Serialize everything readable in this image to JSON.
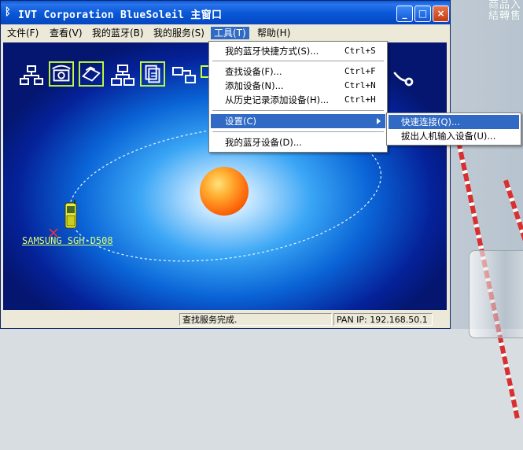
{
  "window": {
    "title": "IVT Corporation BlueSoleil 主窗口",
    "minimize": "_",
    "maximize": "□",
    "close": "×"
  },
  "menubar": [
    {
      "label": "文件(F)"
    },
    {
      "label": "查看(V)"
    },
    {
      "label": "我的蓝牙(B)"
    },
    {
      "label": "我的服务(S)"
    },
    {
      "label": "工具(T)"
    },
    {
      "label": "帮助(H)"
    }
  ],
  "tools_menu": {
    "items": [
      {
        "label": "我的蓝牙快捷方式(S)...",
        "shortcut": "Ctrl+S"
      },
      {
        "label": "查找设备(F)...",
        "shortcut": "Ctrl+F"
      },
      {
        "label": "添加设备(N)...",
        "shortcut": "Ctrl+N"
      },
      {
        "label": "从历史记录添加设备(H)...",
        "shortcut": "Ctrl+H"
      },
      {
        "label": "设置(C)",
        "shortcut": ""
      },
      {
        "label": "我的蓝牙设备(D)...",
        "shortcut": ""
      }
    ]
  },
  "settings_submenu": {
    "items": [
      {
        "label": "快速连接(Q)..."
      },
      {
        "label": "拔出人机输入设备(U)..."
      }
    ]
  },
  "device": {
    "name": "SAMSUNG SGH-D508"
  },
  "statusbar": {
    "message": "查找服务完成.",
    "pan_ip": "PAN IP: 192.168.50.1"
  },
  "desktop": {
    "line1": "商品入",
    "line2": "結轉售"
  }
}
